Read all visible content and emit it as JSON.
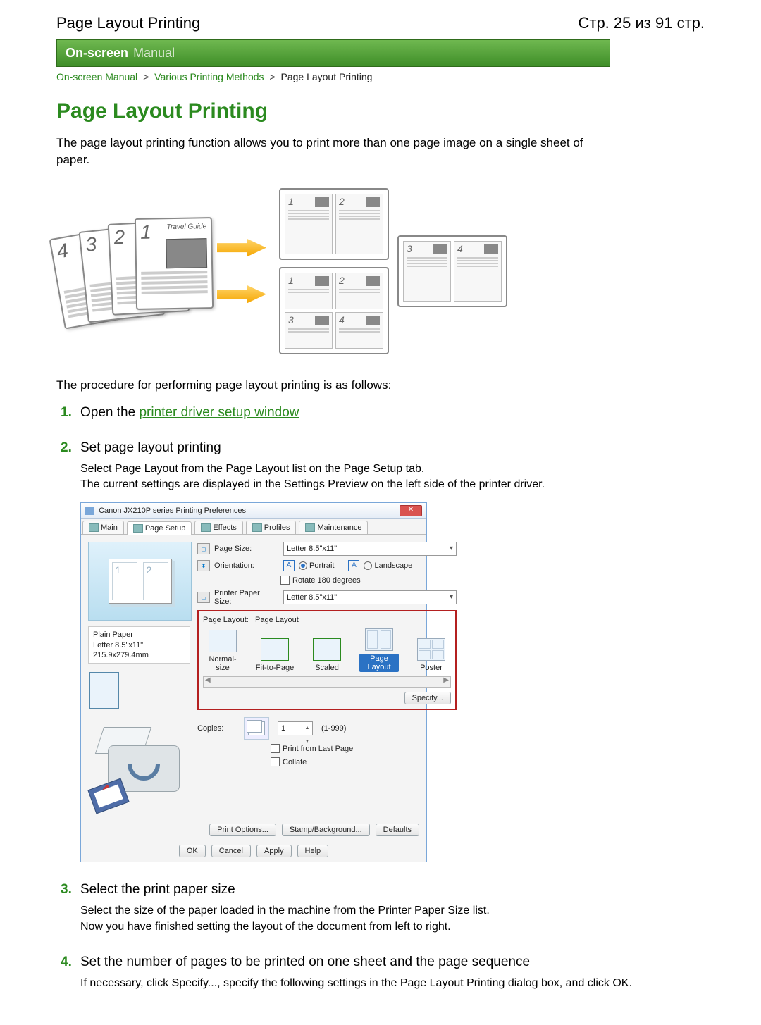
{
  "header": {
    "left": "Page Layout Printing",
    "right": "Стр. 25 из 91 стр."
  },
  "banner": {
    "strong": "On-screen",
    "rest": "Manual"
  },
  "breadcrumb": {
    "a": "On-screen Manual",
    "b": "Various Printing Methods",
    "current": "Page Layout Printing",
    "sep": ">"
  },
  "title": "Page Layout Printing",
  "intro": "The page layout printing function allows you to print more than one page image on a single sheet of paper.",
  "concept": {
    "thumb_title": "Travel Guide",
    "nums": [
      "1",
      "2",
      "3",
      "4"
    ]
  },
  "procedure_lead": "The procedure for performing page layout printing is as follows:",
  "steps": {
    "s1": {
      "lead": "Open the ",
      "link": "printer driver setup window"
    },
    "s2": {
      "head": "Set page layout printing",
      "body1": "Select Page Layout from the Page Layout list on the Page Setup tab.",
      "body2": "The current settings are displayed in the Settings Preview on the left side of the printer driver."
    },
    "s3": {
      "head": "Select the print paper size",
      "body1": "Select the size of the paper loaded in the machine from the Printer Paper Size list.",
      "body2": "Now you have finished setting the layout of the document from left to right."
    },
    "s4": {
      "head": "Set the number of pages to be printed on one sheet and the page sequence",
      "body": "If necessary, click Specify..., specify the following settings in the Page Layout Printing dialog box, and click OK."
    }
  },
  "dialog": {
    "title": "Canon JX210P series Printing Preferences",
    "close_glyph": "✕",
    "tabs": [
      "Main",
      "Page Setup",
      "Effects",
      "Profiles",
      "Maintenance"
    ],
    "active_tab_index": 1,
    "paper_info": {
      "line1": "Plain Paper",
      "line2": "Letter 8.5\"x11\" 215.9x279.4mm"
    },
    "labels": {
      "page_size": "Page Size:",
      "orientation": "Orientation:",
      "portrait": "Portrait",
      "landscape": "Landscape",
      "rotate": "Rotate 180 degrees",
      "printer_paper_size": "Printer Paper Size:",
      "page_layout_lbl": "Page Layout:",
      "page_layout_val": "Page Layout",
      "copies": "Copies:",
      "copies_range": "(1-999)",
      "print_last": "Print from Last Page",
      "collate": "Collate",
      "specify": "Specify...",
      "print_options": "Print Options...",
      "stamp_bg": "Stamp/Background...",
      "defaults": "Defaults",
      "ok": "OK",
      "cancel": "Cancel",
      "apply": "Apply",
      "help": "Help",
      "A": "A"
    },
    "values": {
      "page_size": "Letter 8.5\"x11\"",
      "printer_paper_size": "Letter 8.5\"x11\"",
      "copies": "1"
    },
    "layout_opts": [
      "Normal-size",
      "Fit-to-Page",
      "Scaled",
      "Page Layout",
      "Poster"
    ],
    "layout_selected_index": 3
  }
}
